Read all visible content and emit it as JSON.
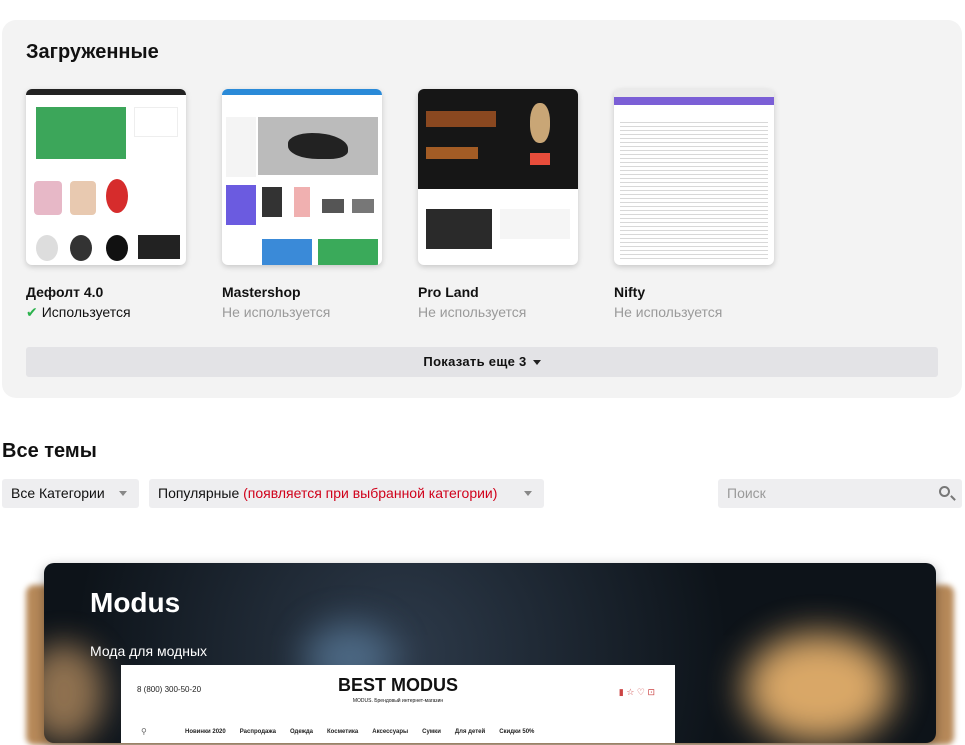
{
  "uploaded": {
    "title": "Загруженные",
    "themes": [
      {
        "name": "Дефолт 4.0",
        "status": "Используется",
        "active": true
      },
      {
        "name": "Mastershop",
        "status": "Не используется",
        "active": false
      },
      {
        "name": "Pro Land",
        "status": "Не используется",
        "active": false
      },
      {
        "name": "Nifty",
        "status": "Не используется",
        "active": false
      }
    ],
    "show_more": "Показать еще 3"
  },
  "all": {
    "title": "Все темы",
    "category_select": "Все Категории",
    "sort_select": "Популярные",
    "sort_hint": "(появляется при выбранной категории)",
    "search_placeholder": "Поиск"
  },
  "featured": {
    "title": "Modus",
    "subtitle": "Мода для модных",
    "preview": {
      "phone": "8 (800) 300-50-20",
      "logo": "BEST MODUS",
      "tagline": "MODUS. Брендовый интернет-магазин",
      "nav": [
        "Новинки 2020",
        "Распродажа",
        "Одежда",
        "Косметика",
        "Аксессуары",
        "Сумки",
        "Для детей",
        "Скидки 50%"
      ]
    }
  },
  "colors": {
    "accent_check": "#2bb24c",
    "hint_red": "#d0021b",
    "panel": "#f3f3f3"
  }
}
